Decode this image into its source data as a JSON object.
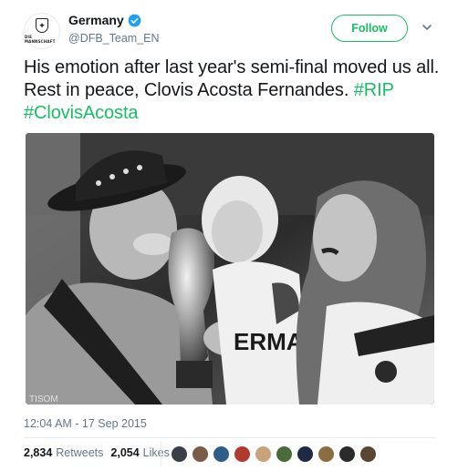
{
  "account": {
    "display_name": "Germany",
    "handle": "@DFB_Team_EN",
    "avatar_text": "DIE MANNSCHAFT",
    "verified": true
  },
  "actions": {
    "follow_label": "Follow"
  },
  "tweet": {
    "text": "His emotion after last year's semi-final moved us all. Rest in peace, Clovis Acosta Fernandes.",
    "hashtags": [
      "#RIP",
      "#ClovisAcosta"
    ],
    "timestamp": "12:04 AM - 17 Sep 2015"
  },
  "image": {
    "shirt_text": "ERMA",
    "corner_text": "TISOM"
  },
  "stats": {
    "retweets_count": "2,834",
    "retweets_label": "Retweets",
    "likes_count": "2,054",
    "likes_label": "Likes"
  },
  "colors": {
    "accent": "#17bf63",
    "verified": "#1da1f2",
    "muted": "#657786",
    "text": "#14171a"
  },
  "likers": [
    {
      "name": "liker-avatar-1",
      "color": "#3a3f48"
    },
    {
      "name": "liker-avatar-2",
      "color": "#7a5a48"
    },
    {
      "name": "liker-avatar-3",
      "color": "#2f5d8a"
    },
    {
      "name": "liker-avatar-4",
      "color": "#b03a2e"
    },
    {
      "name": "liker-avatar-5",
      "color": "#c7a27a"
    },
    {
      "name": "liker-avatar-6",
      "color": "#4a6b3c"
    },
    {
      "name": "liker-avatar-7",
      "color": "#1f2a44"
    },
    {
      "name": "liker-avatar-8",
      "color": "#8c6d3f"
    },
    {
      "name": "liker-avatar-9",
      "color": "#2b2b2b"
    },
    {
      "name": "liker-avatar-10",
      "color": "#5a4632"
    }
  ]
}
